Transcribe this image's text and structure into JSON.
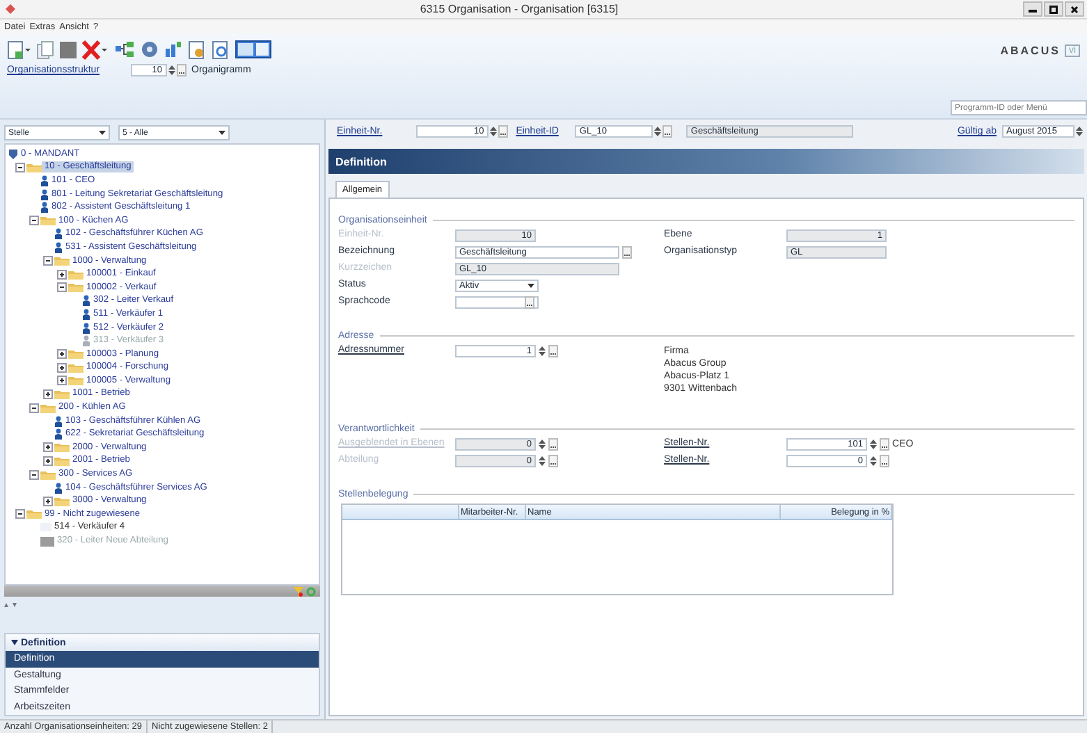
{
  "window": {
    "title": "6315 Organisation - Organisation [6315]"
  },
  "menu": [
    "Datei",
    "Extras",
    "Ansicht",
    "?"
  ],
  "toolbar": {
    "row": {
      "link": "Organisationsstruktur",
      "value": "10",
      "label": "Organigramm"
    },
    "logo": "ABACUS",
    "logo_badge": "vi",
    "search": {
      "placeholder": "Programm-ID oder Menü"
    }
  },
  "filters": [
    {
      "value": "Stelle"
    },
    {
      "value": "5 - Alle"
    }
  ],
  "tree": [
    {
      "label": "0 - MANDANT",
      "kind": "root",
      "selected": false,
      "children": [
        {
          "label": "10 - Geschäftsleitung",
          "kind": "folder",
          "expanded": true,
          "selected": true,
          "children": [
            {
              "label": "101 - CEO",
              "kind": "person",
              "selected": false
            },
            {
              "label": "801 - Leitung Sekretariat Geschäftsleitung",
              "kind": "person",
              "selected": false
            },
            {
              "label": "802 - Assistent Geschäftsleitung 1",
              "kind": "person",
              "selected": false
            },
            {
              "label": "100 - Küchen AG",
              "kind": "folder",
              "expanded": true,
              "selected": false,
              "children": [
                {
                  "label": "102 - Geschäftsführer Küchen AG",
                  "kind": "person",
                  "selected": false
                },
                {
                  "label": "531 - Assistent Geschäftsleitung",
                  "kind": "person",
                  "selected": false
                },
                {
                  "label": "1000 - Verwaltung",
                  "kind": "folder",
                  "expanded": true,
                  "selected": false,
                  "children": [
                    {
                      "label": "100001 - Einkauf",
                      "kind": "folder",
                      "expanded": false,
                      "selected": false
                    },
                    {
                      "label": "100002 - Verkauf",
                      "kind": "folder",
                      "expanded": true,
                      "selected": false,
                      "children": [
                        {
                          "label": "302 - Leiter Verkauf",
                          "kind": "person",
                          "selected": false
                        },
                        {
                          "label": "511 - Verkäufer 1",
                          "kind": "person",
                          "selected": false
                        },
                        {
                          "label": "512 - Verkäufer 2",
                          "kind": "person",
                          "selected": false
                        },
                        {
                          "label": "313 - Verkäufer 3",
                          "kind": "inactive",
                          "selected": false
                        }
                      ]
                    },
                    {
                      "label": "100003 - Planung",
                      "kind": "folder",
                      "expanded": false,
                      "selected": false
                    },
                    {
                      "label": "100004 - Forschung",
                      "kind": "folder",
                      "expanded": false,
                      "selected": false
                    },
                    {
                      "label": "100005 - Verwaltung",
                      "kind": "folder",
                      "expanded": false,
                      "selected": false
                    }
                  ]
                },
                {
                  "label": "1001 - Betrieb",
                  "kind": "folder",
                  "expanded": false,
                  "selected": false
                }
              ]
            },
            {
              "label": "200 - Kühlen AG",
              "kind": "folder",
              "expanded": true,
              "selected": false,
              "children": [
                {
                  "label": "103 - Geschäftsführer Kühlen AG",
                  "kind": "person",
                  "selected": false
                },
                {
                  "label": "622 - Sekretariat Geschäftsleitung",
                  "kind": "person",
                  "selected": false
                },
                {
                  "label": "2000 - Verwaltung",
                  "kind": "folder",
                  "expanded": false,
                  "selected": false
                },
                {
                  "label": "2001 - Betrieb",
                  "kind": "folder",
                  "expanded": false,
                  "selected": false
                }
              ]
            },
            {
              "label": "300 - Services AG",
              "kind": "folder",
              "expanded": true,
              "selected": false,
              "children": [
                {
                  "label": "104 - Geschäftsführer Services AG",
                  "kind": "person",
                  "selected": false
                },
                {
                  "label": "3000 - Verwaltung",
                  "kind": "folder",
                  "expanded": false,
                  "selected": false
                }
              ]
            }
          ]
        },
        {
          "label": "99 - Nicht zugewiesene",
          "kind": "folder",
          "expanded": true,
          "selected": false,
          "children": [
            {
              "label": "514 - Verkäufer 4",
              "kind": "vacant",
              "selected": false
            },
            {
              "label": "320 - Leiter Neue Abteilung",
              "kind": "placeholder",
              "selected": false
            }
          ]
        }
      ]
    }
  ],
  "navigator": {
    "title": "Definition",
    "expanded": true,
    "items": [
      {
        "label": "Definition",
        "selected": true
      },
      {
        "label": "Gestaltung",
        "selected": false
      },
      {
        "label": "Stammfelder",
        "selected": false
      },
      {
        "label": "Arbeitszeiten",
        "selected": false
      }
    ]
  },
  "header": {
    "unit_no": {
      "label": "Einheit-Nr.",
      "value": "10"
    },
    "unit_id": {
      "label": "Einheit-ID",
      "value": "GL_10"
    },
    "name": "Geschäftsleitung",
    "valid_from": {
      "label": "Gültig ab",
      "value": "August 2015"
    }
  },
  "panel_title": "Definition",
  "tabs": [
    {
      "label": "Allgemein",
      "selected": true
    }
  ],
  "sections": [
    {
      "title": "Organisationseinheit",
      "rows": [
        [
          {
            "label": "Einheit-Nr.",
            "kind": "number",
            "link": false,
            "disabled": true,
            "value": "10"
          },
          {
            "label": "Ebene",
            "kind": "short",
            "link": false,
            "disabled": false,
            "value": "1"
          }
        ],
        [
          {
            "label": "Bezeichnung",
            "kind": "text-browse",
            "link": false,
            "disabled": false,
            "value": "Geschäftsleitung"
          },
          {
            "label": "Organisationstyp",
            "kind": "short-text",
            "link": false,
            "disabled": false,
            "value": "GL"
          }
        ],
        [
          {
            "label": "Kurzzeichen",
            "kind": "text",
            "link": false,
            "disabled": true,
            "value": "GL_10"
          }
        ],
        [
          {
            "label": "Status",
            "kind": "select",
            "link": false,
            "disabled": false,
            "value": "Aktiv"
          }
        ],
        [
          {
            "label": "Sprachcode",
            "kind": "browse",
            "link": false,
            "disabled": false
          }
        ]
      ]
    },
    {
      "title": "Adresse",
      "rows": [
        [
          {
            "label": "Adressnummer",
            "kind": "spin",
            "link": true,
            "disabled": false,
            "value": "1"
          },
          {
            "kind": "address",
            "lines": [
              "Firma",
              "Abacus Group",
              "Abacus-Platz 1",
              "9301 Wittenbach"
            ]
          }
        ]
      ]
    },
    {
      "title": "Verantwortlichkeit",
      "rows": [
        [
          {
            "label": "Ausgeblendet in Ebenen",
            "kind": "spin",
            "link": true,
            "disabled": true,
            "value": "0"
          },
          {
            "label": "Stellen-Nr.",
            "kind": "spin",
            "link": true,
            "disabled": false,
            "value": "101",
            "note": "CEO"
          }
        ],
        [
          {
            "label": "Abteilung",
            "kind": "spin",
            "link": false,
            "disabled": true,
            "value": "0"
          },
          {
            "label": "Stellen-Nr.",
            "kind": "spin",
            "link": true,
            "disabled": false,
            "value": "0"
          }
        ]
      ]
    },
    {
      "title": "Stellenbelegung",
      "table": {
        "columns": [
          "Mitarbeiter-Nr.",
          "Name",
          "Belegung in %"
        ]
      }
    }
  ],
  "status_bar": [
    "Anzahl Organisationseinheiten: 29",
    "Nicht zugewiesene Stellen: 2"
  ]
}
